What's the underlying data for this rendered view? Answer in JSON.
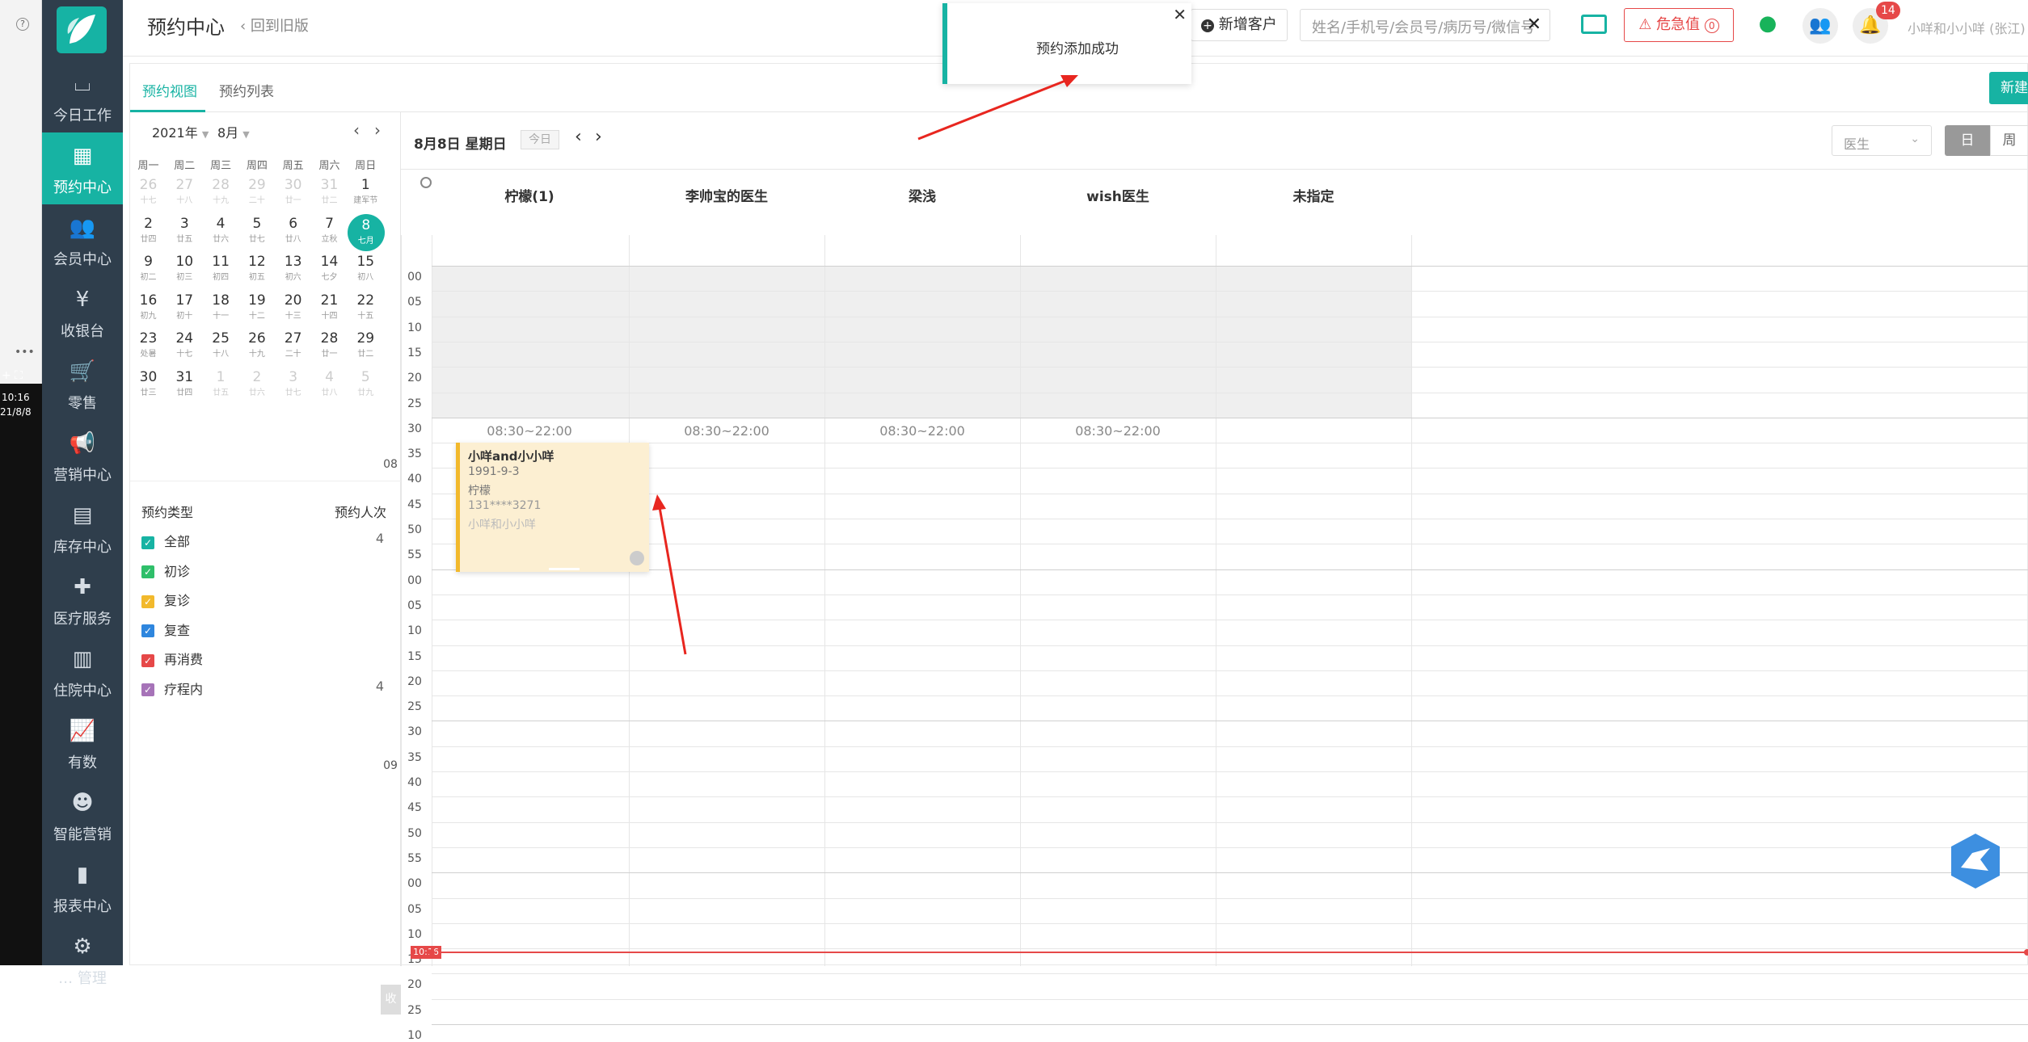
{
  "app": {
    "title": "预约中心",
    "back_link": "回到旧版"
  },
  "edge": {
    "time": "10:16",
    "date": "21/8/8"
  },
  "sidebar": {
    "items": [
      {
        "label": "今日工作",
        "icon": "desk-icon"
      },
      {
        "label": "预约中心",
        "icon": "calendar-icon"
      },
      {
        "label": "会员中心",
        "icon": "members-icon"
      },
      {
        "label": "收银台",
        "icon": "yen-icon"
      },
      {
        "label": "零售",
        "icon": "cart-icon"
      },
      {
        "label": "营销中心",
        "icon": "megaphone-icon"
      },
      {
        "label": "库存中心",
        "icon": "grid-icon"
      },
      {
        "label": "医疗服务",
        "icon": "medkit-icon"
      },
      {
        "label": "住院中心",
        "icon": "building-icon"
      },
      {
        "label": "有数",
        "icon": "trend-icon"
      },
      {
        "label": "智能营销",
        "icon": "robot-icon"
      },
      {
        "label": "报表中心",
        "icon": "barchart-icon"
      },
      {
        "label": "… 管理",
        "icon": "gear-icon"
      }
    ]
  },
  "header": {
    "add_customer": "新增客户",
    "search_placeholder": "姓名/手机号/会员号/病历号/微信号",
    "critical_label": "危急值",
    "critical_count": "0",
    "badge": "14",
    "user": "小咩和小小咩 (张江)"
  },
  "toast": {
    "message": "预约添加成功"
  },
  "tabs": [
    "预约视图",
    "预约列表"
  ],
  "new_button": "新建",
  "calendar": {
    "year": "2021年",
    "month": "8月",
    "weekdays": [
      "周一",
      "周二",
      "周三",
      "周四",
      "周五",
      "周六",
      "周日"
    ],
    "weeks": [
      [
        [
          "26",
          "十七",
          1
        ],
        [
          "27",
          "十八",
          1
        ],
        [
          "28",
          "十九",
          1
        ],
        [
          "29",
          "二十",
          1
        ],
        [
          "30",
          "廿一",
          1
        ],
        [
          "31",
          "廿二",
          1
        ],
        [
          "1",
          "建军节",
          0
        ]
      ],
      [
        [
          "2",
          "廿四",
          0
        ],
        [
          "3",
          "廿五",
          0
        ],
        [
          "4",
          "廿六",
          0
        ],
        [
          "5",
          "廿七",
          0
        ],
        [
          "6",
          "廿八",
          0
        ],
        [
          "7",
          "立秋",
          0
        ],
        [
          "8",
          "七月",
          0
        ]
      ],
      [
        [
          "9",
          "初二",
          0
        ],
        [
          "10",
          "初三",
          0
        ],
        [
          "11",
          "初四",
          0
        ],
        [
          "12",
          "初五",
          0
        ],
        [
          "13",
          "初六",
          0
        ],
        [
          "14",
          "七夕",
          0
        ],
        [
          "15",
          "初八",
          0
        ]
      ],
      [
        [
          "16",
          "初九",
          0
        ],
        [
          "17",
          "初十",
          0
        ],
        [
          "18",
          "十一",
          0
        ],
        [
          "19",
          "十二",
          0
        ],
        [
          "20",
          "十三",
          0
        ],
        [
          "21",
          "十四",
          0
        ],
        [
          "22",
          "十五",
          0
        ]
      ],
      [
        [
          "23",
          "处暑",
          0
        ],
        [
          "24",
          "十七",
          0
        ],
        [
          "25",
          "十八",
          0
        ],
        [
          "26",
          "十九",
          0
        ],
        [
          "27",
          "二十",
          0
        ],
        [
          "28",
          "廿一",
          0
        ],
        [
          "29",
          "廿二",
          0
        ]
      ],
      [
        [
          "30",
          "廿三",
          0
        ],
        [
          "31",
          "廿四",
          0
        ],
        [
          "1",
          "廿五",
          1
        ],
        [
          "2",
          "廿六",
          1
        ],
        [
          "3",
          "廿七",
          1
        ],
        [
          "4",
          "廿八",
          1
        ],
        [
          "5",
          "廿九",
          1
        ]
      ]
    ]
  },
  "types": {
    "header_left": "预约类型",
    "header_right": "预约人次",
    "items": [
      {
        "label": "全部",
        "count": "4",
        "color": "#17b3a3"
      },
      {
        "label": "初诊",
        "count": "",
        "color": "#2fbf6a"
      },
      {
        "label": "复诊",
        "count": "",
        "color": "#f2b92c"
      },
      {
        "label": "复查",
        "count": "",
        "color": "#2e86de"
      },
      {
        "label": "再消费",
        "count": "",
        "color": "#e64848"
      },
      {
        "label": "疗程内",
        "count": "4",
        "color": "#a673b8"
      }
    ]
  },
  "schedule": {
    "date": "8月8日 星期日",
    "today": "今日",
    "filter": "医生",
    "view_day": "日",
    "view_week": "周",
    "columns": [
      "柠檬(1)",
      "李帅宝的医生",
      "梁浅",
      "wish医生",
      "未指定"
    ],
    "hours_text": "08:30~22:00",
    "hour_labels": [
      "08",
      "09"
    ],
    "minute_labels": [
      "00",
      "05",
      "10",
      "15",
      "20",
      "25",
      "30",
      "35",
      "40",
      "45",
      "50",
      "55",
      "00",
      "05",
      "10",
      "15",
      "20",
      "25",
      "30",
      "35",
      "40",
      "45",
      "50",
      "55",
      "00",
      "05",
      "10",
      "15",
      "20",
      "25",
      "10"
    ],
    "now": "10:16",
    "appointment": {
      "name": "小咩and小小咩",
      "birthday": "1991-9-3",
      "doctor": "柠檬",
      "phone": "131****3271",
      "owner": "小咩和小小咩"
    }
  },
  "collapse": "收"
}
